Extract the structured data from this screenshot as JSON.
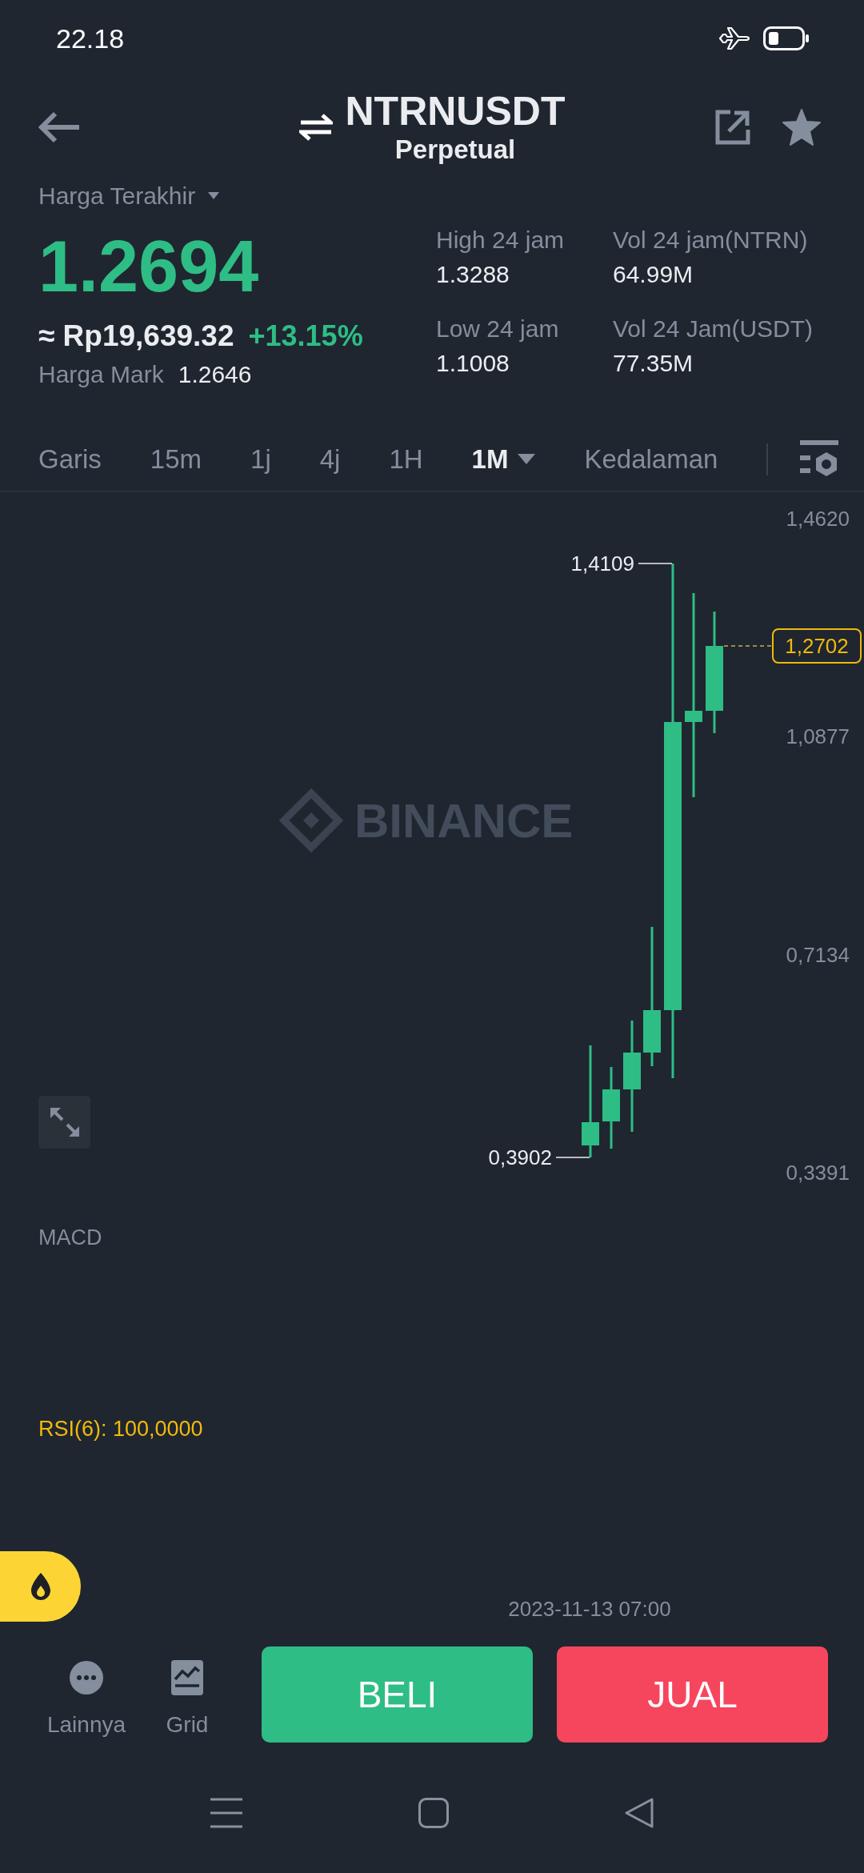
{
  "status_bar": {
    "time": "22.18"
  },
  "header": {
    "title": "NTRNUSDT",
    "subtitle": "Perpetual"
  },
  "ticker": {
    "price_label": "Harga Terakhir",
    "last_price": "1.2694",
    "fiat_price": "≈ Rp19,639.32",
    "change": "+13.15%",
    "mark_label": "Harga Mark",
    "mark_price": "1.2646"
  },
  "stats": [
    {
      "label": "High 24 jam",
      "value": "1.3288"
    },
    {
      "label": "Vol 24 jam(NTRN)",
      "value": "64.99M"
    },
    {
      "label": "Low 24 jam",
      "value": "1.1008"
    },
    {
      "label": "Vol 24 Jam(USDT)",
      "value": "77.35M"
    }
  ],
  "intervals": [
    {
      "label": "Garis",
      "selected": false,
      "dropdown": false
    },
    {
      "label": "15m",
      "selected": false,
      "dropdown": false
    },
    {
      "label": "1j",
      "selected": false,
      "dropdown": false
    },
    {
      "label": "4j",
      "selected": false,
      "dropdown": false
    },
    {
      "label": "1H",
      "selected": false,
      "dropdown": false
    },
    {
      "label": "1M",
      "selected": true,
      "dropdown": true
    },
    {
      "label": "Kedalaman",
      "selected": false,
      "dropdown": false
    }
  ],
  "chart": {
    "watermark": "BINANCE",
    "price_axis": [
      "1,4620",
      "1,0877",
      "0,7134",
      "0,3391"
    ],
    "high_label": "1,4109",
    "low_label": "0,3902",
    "current_price": "1,2702"
  },
  "indicators": {
    "macd": "MACD",
    "rsi": "RSI(6): 100,0000"
  },
  "timestamp": "2023-11-13 07:00",
  "bottom_bar": {
    "tools": [
      {
        "label": "Lainnya",
        "kind": "more"
      },
      {
        "label": "Grid",
        "kind": "grid"
      }
    ],
    "buy": "BELI",
    "sell": "JUAL"
  }
}
